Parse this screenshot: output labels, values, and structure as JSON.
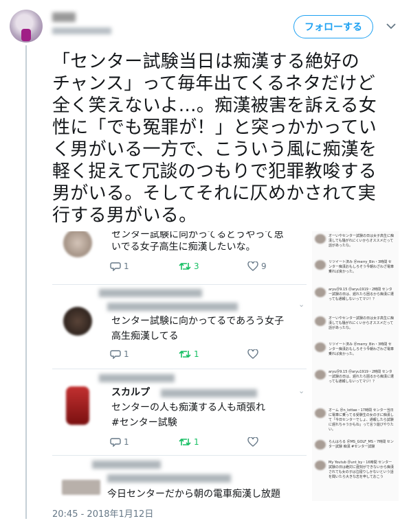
{
  "header": {
    "follow_label": "フォローする",
    "caret": "⌄"
  },
  "tweet": {
    "text": "「センター試験当日は痴漢する絶好の\nチャンス」って毎年出てくるネタだけど\n全く笑えないよ…。痴漢被害を訴える女\n性に「でも冤罪が！」と突っかかってい\nく男がいる一方で、こういう風に痴漢を\n軽く捉えて冗談のつもりで犯罪教唆する\n男がいる。そしてそれに仄めかされて実\n行する男がいる。",
    "timestamp": "20:45 - 2018年1月12日"
  },
  "embedded": {
    "cards": [
      {
        "text_line1": "センター試験に向かってるどうやって思",
        "text_line2": "いでる女子高生に痴漢したいな。",
        "replies": "1",
        "retweets": "3",
        "likes": "9"
      },
      {
        "text_line1": "センター試験に向かってるであろう女子",
        "text_line2": "高生痴漢してる",
        "replies": "1",
        "retweets": "1",
        "likes": ""
      },
      {
        "header_visible": "スカルプ",
        "text_line1": "センターの人も痴漢する人も頑張れ",
        "hashtag": "#センター試験",
        "replies": "1",
        "retweets": "1",
        "likes": ""
      },
      {
        "text_line1": "今日センターだから朝の電車痴漢し放題"
      }
    ],
    "sidebar": [
      {
        "text": "オーいやセンター試験の日は女子高生に痴漢しても騒がれにくいからオススメだって話があったな。"
      },
      {
        "text": "リツイート済み ＠merry_Bin・3時間 センター痴漢おもしろそう今朝わざわざ電車乗れば良かった。"
      },
      {
        "text": "aryu＠9.15 ＠aryu1919・2時間 センター試験の日は、遅れたら困るから痴漢に遭っても通報しないってマジ！？"
      },
      {
        "text": "オーいやセンター試験の日は女子高生に痴漢しても騒がれにくいからオススメだって話があったな。"
      },
      {
        "text": "リツイート済み ＠merry_Bin・3時間 センター痴漢おもしろそう今朝わざわざ電車乗れば良かった。"
      },
      {
        "text": "aryu＠9.15 ＠aryu1919・2時間 センター試験の日は、遅れたら困るから痴漢に遭っても通報しないってマジ！？"
      },
      {
        "text": "オーム ＠n_lottae・17時間 センター当日に電車に乗ってる受験生の女の子に痴漢して「今日センターでしょ、通報したら試験に遅れちゃうかもね」って言う遊びやりたい。"
      },
      {
        "text": "らんはらる ＠MS_GOLF_MS・7時間 センター試験 痴漢 #センター試験"
      },
      {
        "text": "My Youtub ＠unt_by・16時間 センター試験の日は絶対に遅刻ができないから痴漢されても女の子は泣寝りしかないという話を聞いたら大きな志を申しておこう"
      }
    ]
  },
  "colors": {
    "accent": "#1da1f2",
    "retweet_green": "#17bf63",
    "muted": "#657786"
  },
  "icons": [
    "reply-icon",
    "retweet-icon",
    "like-icon",
    "chevron-down-icon"
  ]
}
